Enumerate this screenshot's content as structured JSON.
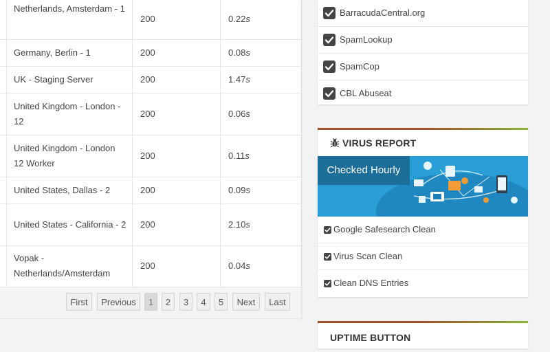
{
  "servers": {
    "rows": [
      {
        "location": "Netherlands, Amsterdam - 1",
        "status": "200",
        "time": "0.22",
        "unit": "s"
      },
      {
        "location": "Germany, Berlin - 1",
        "status": "200",
        "time": "0.08",
        "unit": "s"
      },
      {
        "location": "UK - Staging Server",
        "status": "200",
        "time": "1.47",
        "unit": "s"
      },
      {
        "location": "United Kingdom - London - 12",
        "status": "200",
        "time": "0.06",
        "unit": "s"
      },
      {
        "location": "United Kingdom - London 12 Worker",
        "status": "200",
        "time": "0.11",
        "unit": "s"
      },
      {
        "location": "United States, Dallas - 2",
        "status": "200",
        "time": "0.09",
        "unit": "s"
      },
      {
        "location": "United States - California - 2",
        "status": "200",
        "time": "2.10",
        "unit": "s"
      },
      {
        "location": "Vopak - Netherlands/Amsterdam",
        "status": "200",
        "time": "0.04",
        "unit": "s"
      }
    ]
  },
  "pagination": {
    "first": "First",
    "previous": "Previous",
    "pages": [
      "1",
      "2",
      "3",
      "4",
      "5"
    ],
    "current": "1",
    "next": "Next",
    "last": "Last"
  },
  "blacklist": {
    "items": [
      "BarracudaCentral.org",
      "SpamLookup",
      "SpamCop",
      "CBL Abuseat"
    ]
  },
  "virus_report": {
    "icon": "bug-icon",
    "title": "VIRUS REPORT",
    "banner_text": "Checked Hourly",
    "items": [
      "Google Safesearch Clean",
      "Virus Scan Clean",
      "Clean DNS Entries"
    ]
  },
  "uptime": {
    "title": "UPTIME BUTTON"
  },
  "colors": {
    "accent_bar_left": "#a0522d",
    "accent_bar_right": "#8bb33a",
    "banner_blue": "#2a9ed6",
    "checkbox": "#444444"
  }
}
